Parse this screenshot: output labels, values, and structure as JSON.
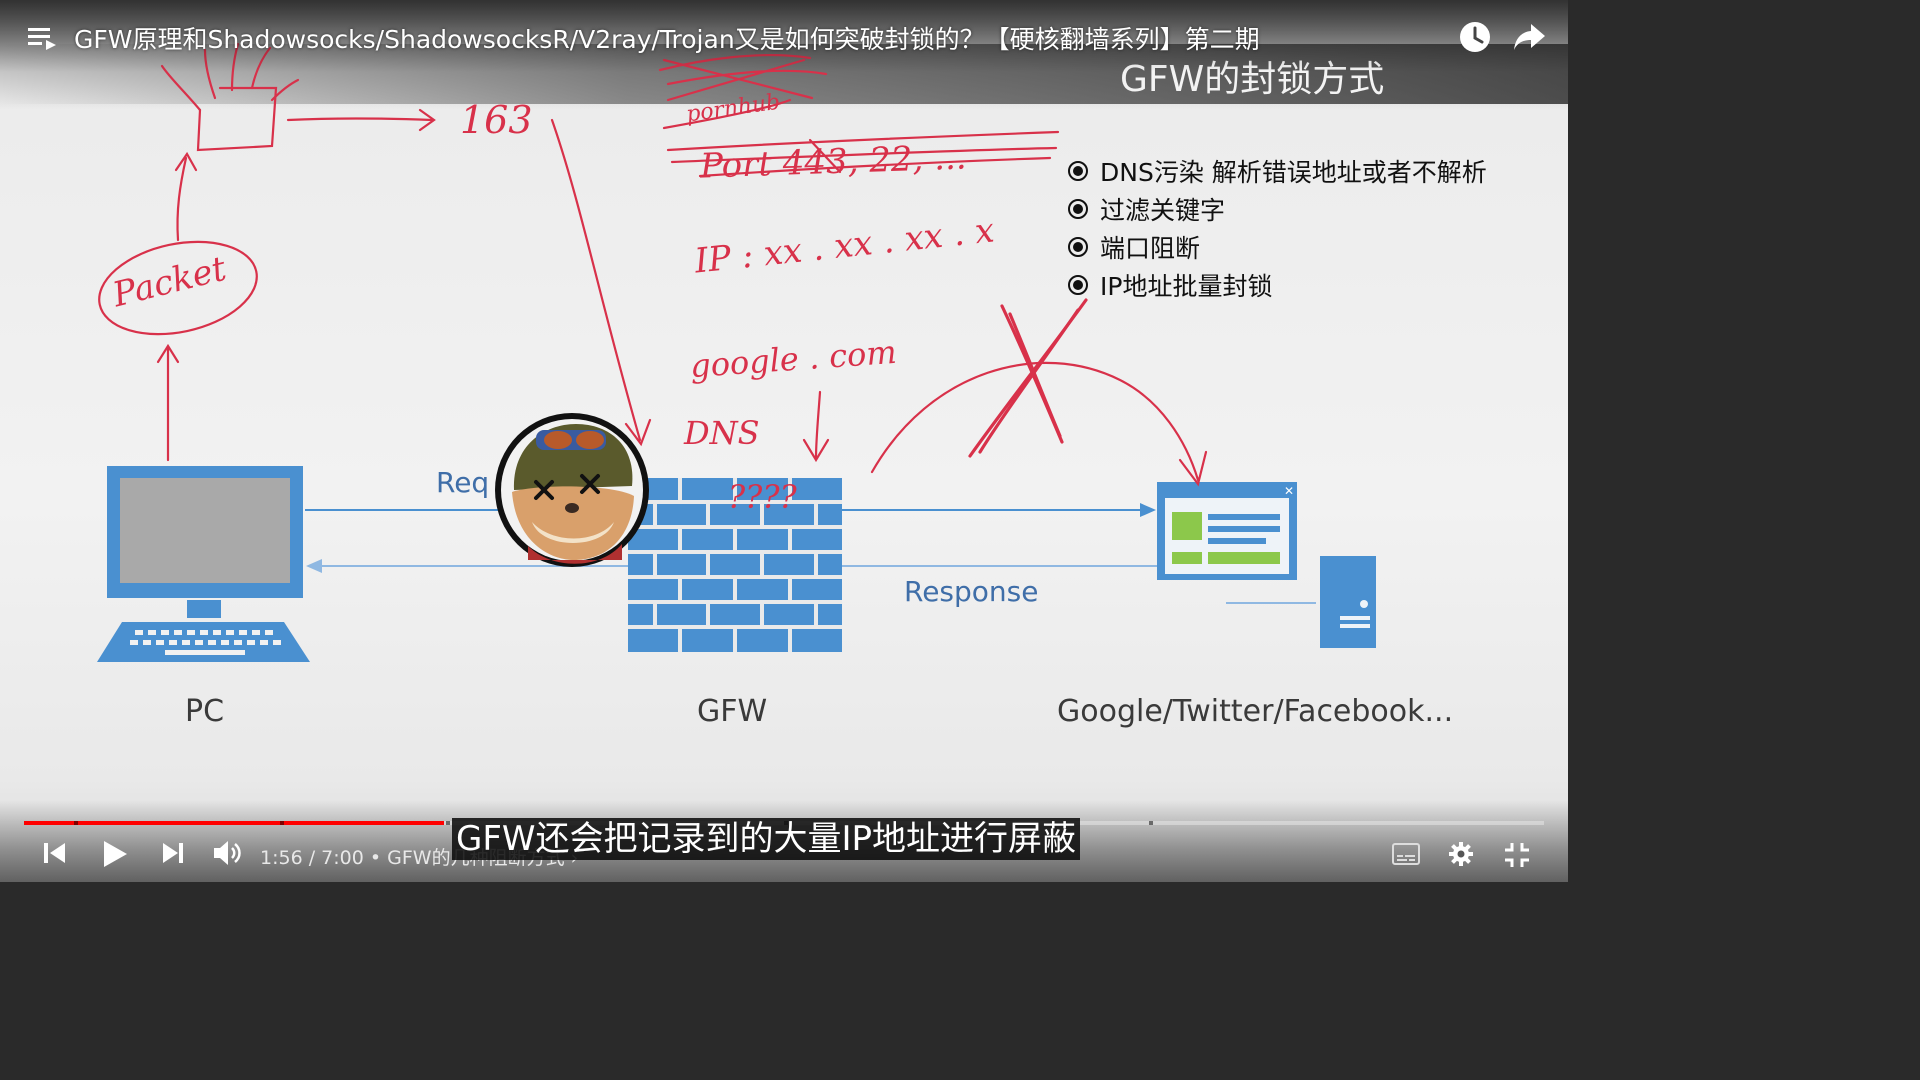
{
  "video": {
    "title": "GFW原理和Shadowsocks/ShadowsocksR/V2ray/Trojan又是如何突破封锁的？【硬核翻墙系列】第二期"
  },
  "slide": {
    "title": "GFW的封锁方式",
    "bullets": [
      "DNS污染 解析错误地址或者不解析",
      "过滤关键字",
      "端口阻断",
      "IP地址批量封锁"
    ],
    "labels": {
      "pc": "PC",
      "gfw": "GFW",
      "sites": "Google/Twitter/Facebook...",
      "request": "Req",
      "response": "Response"
    },
    "handwriting": {
      "n163": "163",
      "packet": "Packet",
      "pornhub": "pornhub",
      "port": "Port 443, 22, ...",
      "ip": "IP :  xx . xx . xx . x",
      "google": "google . com",
      "dns": "DNS",
      "question": "????"
    },
    "colors": {
      "annotation": "#d8314a",
      "diagram_blue": "#4a90d0"
    }
  },
  "player": {
    "time_current": "1:56",
    "time_total": "7:00",
    "time_separator": "/",
    "chapter_title": "• GFW的几种阻断方式 ›",
    "progress": 0.276,
    "caption": "GFW还会把记录到的大量IP地址进行屏蔽",
    "icons": [
      "playlist-icon",
      "clock-icon",
      "share-icon",
      "previous-icon",
      "play-icon",
      "next-icon",
      "volume-icon",
      "subtitles-icon",
      "settings-icon",
      "exit-fullscreen-icon"
    ]
  }
}
